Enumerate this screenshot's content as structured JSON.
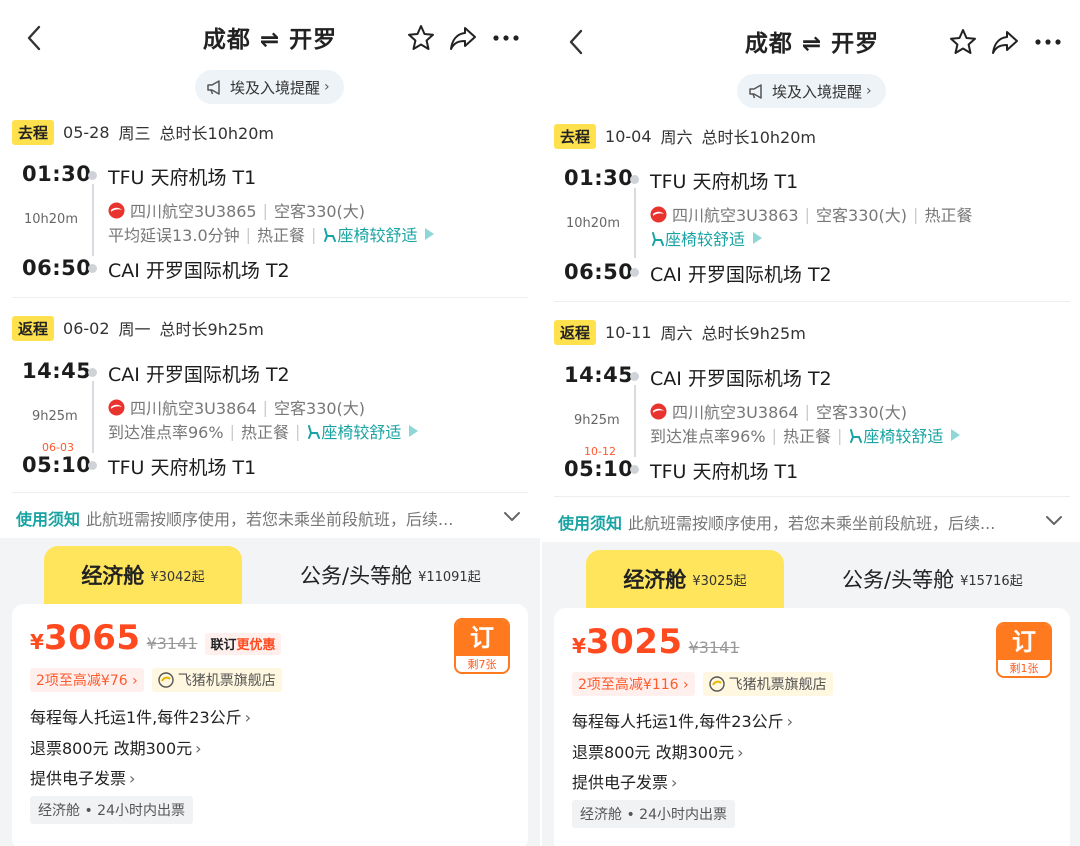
{
  "panels": [
    {
      "header": {
        "origin": "成都",
        "swap": "⇌",
        "dest": "开罗"
      },
      "notice": "埃及入境提醒",
      "outbound": {
        "tag": "去程",
        "date": "05-28",
        "weekday": "周三",
        "duration_total": "总时长10h20m",
        "dep_time": "01:30",
        "dep_airport": "TFU 天府机场 T1",
        "dur": "10h20m",
        "airline": "四川航空3U3865",
        "aircraft": "空客330(大)",
        "info_a": "平均延误13.0分钟",
        "info_b": "热正餐",
        "comfort": "座椅较舒适",
        "arr_time": "06:50",
        "arr_airport": "CAI 开罗国际机场 T2"
      },
      "return": {
        "tag": "返程",
        "date": "06-02",
        "weekday": "周一",
        "duration_total": "总时长9h25m",
        "dep_time": "14:45",
        "dep_airport": "CAI 开罗国际机场 T2",
        "dur": "9h25m",
        "airline": "四川航空3U3864",
        "aircraft": "空客330(大)",
        "info_a": "到达准点率96%",
        "info_b": "热正餐",
        "comfort": "座椅较舒适",
        "arr_date_note": "06-03",
        "arr_time": "05:10",
        "arr_airport": "TFU 天府机场 T1"
      },
      "rules": {
        "label": "使用须知",
        "text": "此航班需按顺序使用，若您未乘坐前段航班，后续..."
      },
      "cabins": {
        "eco": {
          "name": "经济舱",
          "from": "¥3042起"
        },
        "biz": {
          "name": "公务/头等舱",
          "from": "¥11091起"
        }
      },
      "fare": {
        "currency": "¥",
        "price": "3065",
        "orig_price": "¥3141",
        "promo_a": "联订",
        "promo_b": "更优惠",
        "book": "订",
        "remaining": "剩7张",
        "discount": "2项至高减¥76",
        "discount_arrow": "›",
        "shop": "飞猪机票旗舰店",
        "baggage": "每程每人托运1件,每件23公斤",
        "refund": "退票800元 改期300元",
        "invoice": "提供电子发票",
        "tag": "经济舱 • 24小时内出票"
      }
    },
    {
      "header": {
        "origin": "成都",
        "swap": "⇌",
        "dest": "开罗"
      },
      "notice": "埃及入境提醒",
      "outbound": {
        "tag": "去程",
        "date": "10-04",
        "weekday": "周六",
        "duration_total": "总时长10h20m",
        "dep_time": "01:30",
        "dep_airport": "TFU 天府机场 T1",
        "dur": "10h20m",
        "airline": "四川航空3U3863",
        "aircraft": "空客330(大)",
        "info_a": "热正餐",
        "comfort": "座椅较舒适",
        "arr_time": "06:50",
        "arr_airport": "CAI 开罗国际机场 T2"
      },
      "return": {
        "tag": "返程",
        "date": "10-11",
        "weekday": "周六",
        "duration_total": "总时长9h25m",
        "dep_time": "14:45",
        "dep_airport": "CAI 开罗国际机场 T2",
        "dur": "9h25m",
        "airline": "四川航空3U3864",
        "aircraft": "空客330(大)",
        "info_a": "到达准点率96%",
        "info_b": "热正餐",
        "comfort": "座椅较舒适",
        "arr_date_note": "10-12",
        "arr_time": "05:10",
        "arr_airport": "TFU 天府机场 T1"
      },
      "rules": {
        "label": "使用须知",
        "text": "此航班需按顺序使用，若您未乘坐前段航班，后续..."
      },
      "cabins": {
        "eco": {
          "name": "经济舱",
          "from": "¥3025起"
        },
        "biz": {
          "name": "公务/头等舱",
          "from": "¥15716起"
        }
      },
      "fare": {
        "currency": "¥",
        "price": "3025",
        "orig_price": "¥3141",
        "book": "订",
        "remaining": "剩1张",
        "discount": "2项至高减¥116",
        "discount_arrow": "›",
        "shop": "飞猪机票旗舰店",
        "baggage": "每程每人托运1件,每件23公斤",
        "refund": "退票800元 改期300元",
        "invoice": "提供电子发票",
        "tag": "经济舱 • 24小时内出票"
      }
    }
  ],
  "colors": {
    "accent": "#ff4a1f",
    "yellow": "#ffe55c",
    "teal": "#1aa3a3"
  }
}
